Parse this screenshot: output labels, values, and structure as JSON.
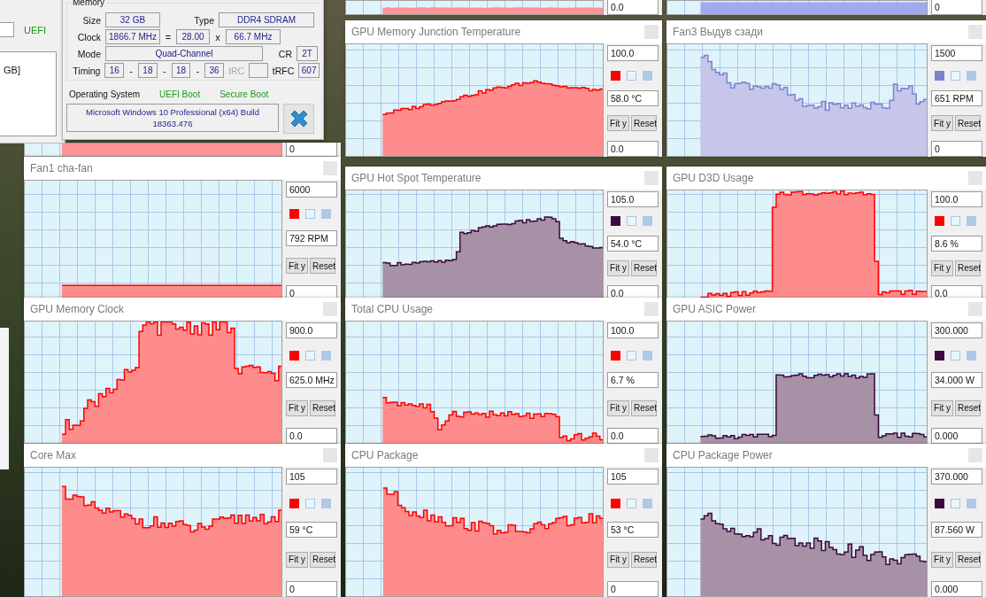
{
  "summary_window": {
    "boot_label": "UEFI",
    "list_text": "GB]"
  },
  "memory_dialog": {
    "group_label": "Memory",
    "size_label": "Size",
    "size": "32 GB",
    "type_label": "Type",
    "type": "DDR4 SDRAM",
    "clock_label": "Clock",
    "clock": "1866.7 MHz",
    "equals": "=",
    "multiplier": "28.00",
    "times": "x",
    "bus_clock": "66.7 MHz",
    "mode_label": "Mode",
    "mode": "Quad-Channel",
    "cr_label": "CR",
    "cr": "2T",
    "timing_label": "Timing",
    "timings": [
      "16",
      "18",
      "18",
      "36"
    ],
    "separators": [
      "-",
      "-",
      "-"
    ],
    "trc_label": "tRC",
    "trfc_label": "tRFC",
    "trfc": "607",
    "os_label": "Operating System",
    "uefi_boot": "UEFI Boot",
    "secure_boot": "Secure Boot",
    "os_name": "Microsoft Windows 10 Professional (x64) Build 18363.476"
  },
  "graphs": [
    {
      "color": "#ff9494",
      "min": "0.0"
    },
    {
      "color": "#a0aaee",
      "min": "0"
    },
    {
      "color": "#ff9494",
      "min": "0"
    },
    {
      "title": "GPU Memory Junction Temperature",
      "color": "#ff0000",
      "max": "100.0",
      "value": "58.0 °C",
      "fit_label": "Fit y",
      "reset_label": "Reset",
      "min": "0.0"
    },
    {
      "title": "Fan3 Выдув сзади",
      "color": "#8080d0",
      "max": "1500",
      "value": "651 RPM",
      "fit_label": "Fit y",
      "reset_label": "Reset",
      "min": "0"
    },
    {
      "title": "Fan1 cha-fan",
      "color": "#ff0000",
      "max": "6000",
      "value": "792 RPM",
      "fit_label": "Fit y",
      "reset_label": "Reset",
      "min": "0"
    },
    {
      "title": "GPU Hot Spot Temperature",
      "color": "#3c0a3c",
      "max": "105.0",
      "value": "54.0 °C",
      "fit_label": "Fit y",
      "reset_label": "Reset",
      "min": "0.0"
    },
    {
      "title": "GPU D3D Usage",
      "color": "#ff0000",
      "max": "100.0",
      "value": "8.6 %",
      "fit_label": "Fit y",
      "reset_label": "Reset",
      "min": "0.0"
    },
    {
      "title": "GPU Memory Clock",
      "color": "#ff0000",
      "max": "900.0",
      "value": "625.0 MHz",
      "fit_label": "Fit y",
      "reset_label": "Reset",
      "min": "0.0"
    },
    {
      "title": "Total CPU Usage",
      "color": "#ff0000",
      "max": "100.0",
      "value": "6.7 %",
      "fit_label": "Fit y",
      "reset_label": "Reset",
      "min": "0.0"
    },
    {
      "title": "GPU ASIC Power",
      "color": "#3c0a3c",
      "max": "300.000",
      "value": "34.000 W",
      "fit_label": "Fit y",
      "reset_label": "Reset",
      "min": "0.000"
    },
    {
      "title": "Core Max",
      "color": "#ff0000",
      "max": "105",
      "value": "59 °C",
      "fit_label": "Fit y",
      "reset_label": "Reset",
      "min": "0"
    },
    {
      "title": "CPU Package",
      "color": "#ff0000",
      "max": "105",
      "value": "53 °C",
      "fit_label": "Fit y",
      "reset_label": "Reset",
      "min": "0"
    },
    {
      "title": "CPU Package Power",
      "color": "#3c0a3c",
      "max": "370.000",
      "value": "87.560 W",
      "fit_label": "Fit y",
      "reset_label": "Reset",
      "min": "0.000"
    }
  ]
}
